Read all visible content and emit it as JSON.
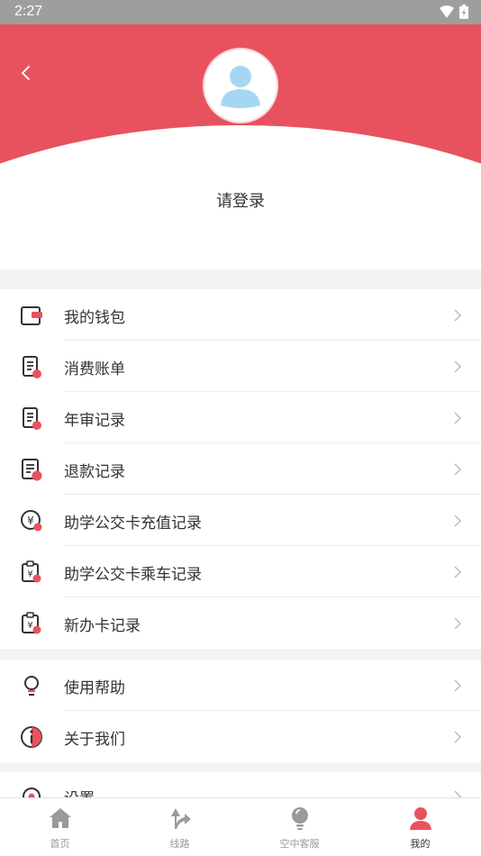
{
  "status_bar": {
    "time": "2:27"
  },
  "profile": {
    "login_prompt": "请登录"
  },
  "colors": {
    "accent": "#e8525f",
    "icon": "#333333",
    "muted": "#9a9a9a"
  },
  "menu_sections": [
    {
      "items": [
        {
          "label": "我的钱包",
          "icon": "wallet-icon"
        },
        {
          "label": "消费账单",
          "icon": "bill-icon"
        },
        {
          "label": "年审记录",
          "icon": "annual-review-icon"
        },
        {
          "label": "退款记录",
          "icon": "refund-icon"
        },
        {
          "label": "助学公交卡充值记录",
          "icon": "recharge-icon"
        },
        {
          "label": "助学公交卡乘车记录",
          "icon": "ride-record-icon"
        },
        {
          "label": "新办卡记录",
          "icon": "new-card-icon"
        }
      ]
    },
    {
      "items": [
        {
          "label": "使用帮助",
          "icon": "lightbulb-icon"
        },
        {
          "label": "关于我们",
          "icon": "info-icon"
        }
      ]
    },
    {
      "items": [
        {
          "label": "设置",
          "icon": "settings-icon"
        }
      ]
    }
  ],
  "tabbar": [
    {
      "label": "首页",
      "icon": "home-icon"
    },
    {
      "label": "线路",
      "icon": "route-icon"
    },
    {
      "label": "空中客服",
      "icon": "service-icon"
    },
    {
      "label": "我的",
      "icon": "user-icon",
      "active": true
    }
  ]
}
